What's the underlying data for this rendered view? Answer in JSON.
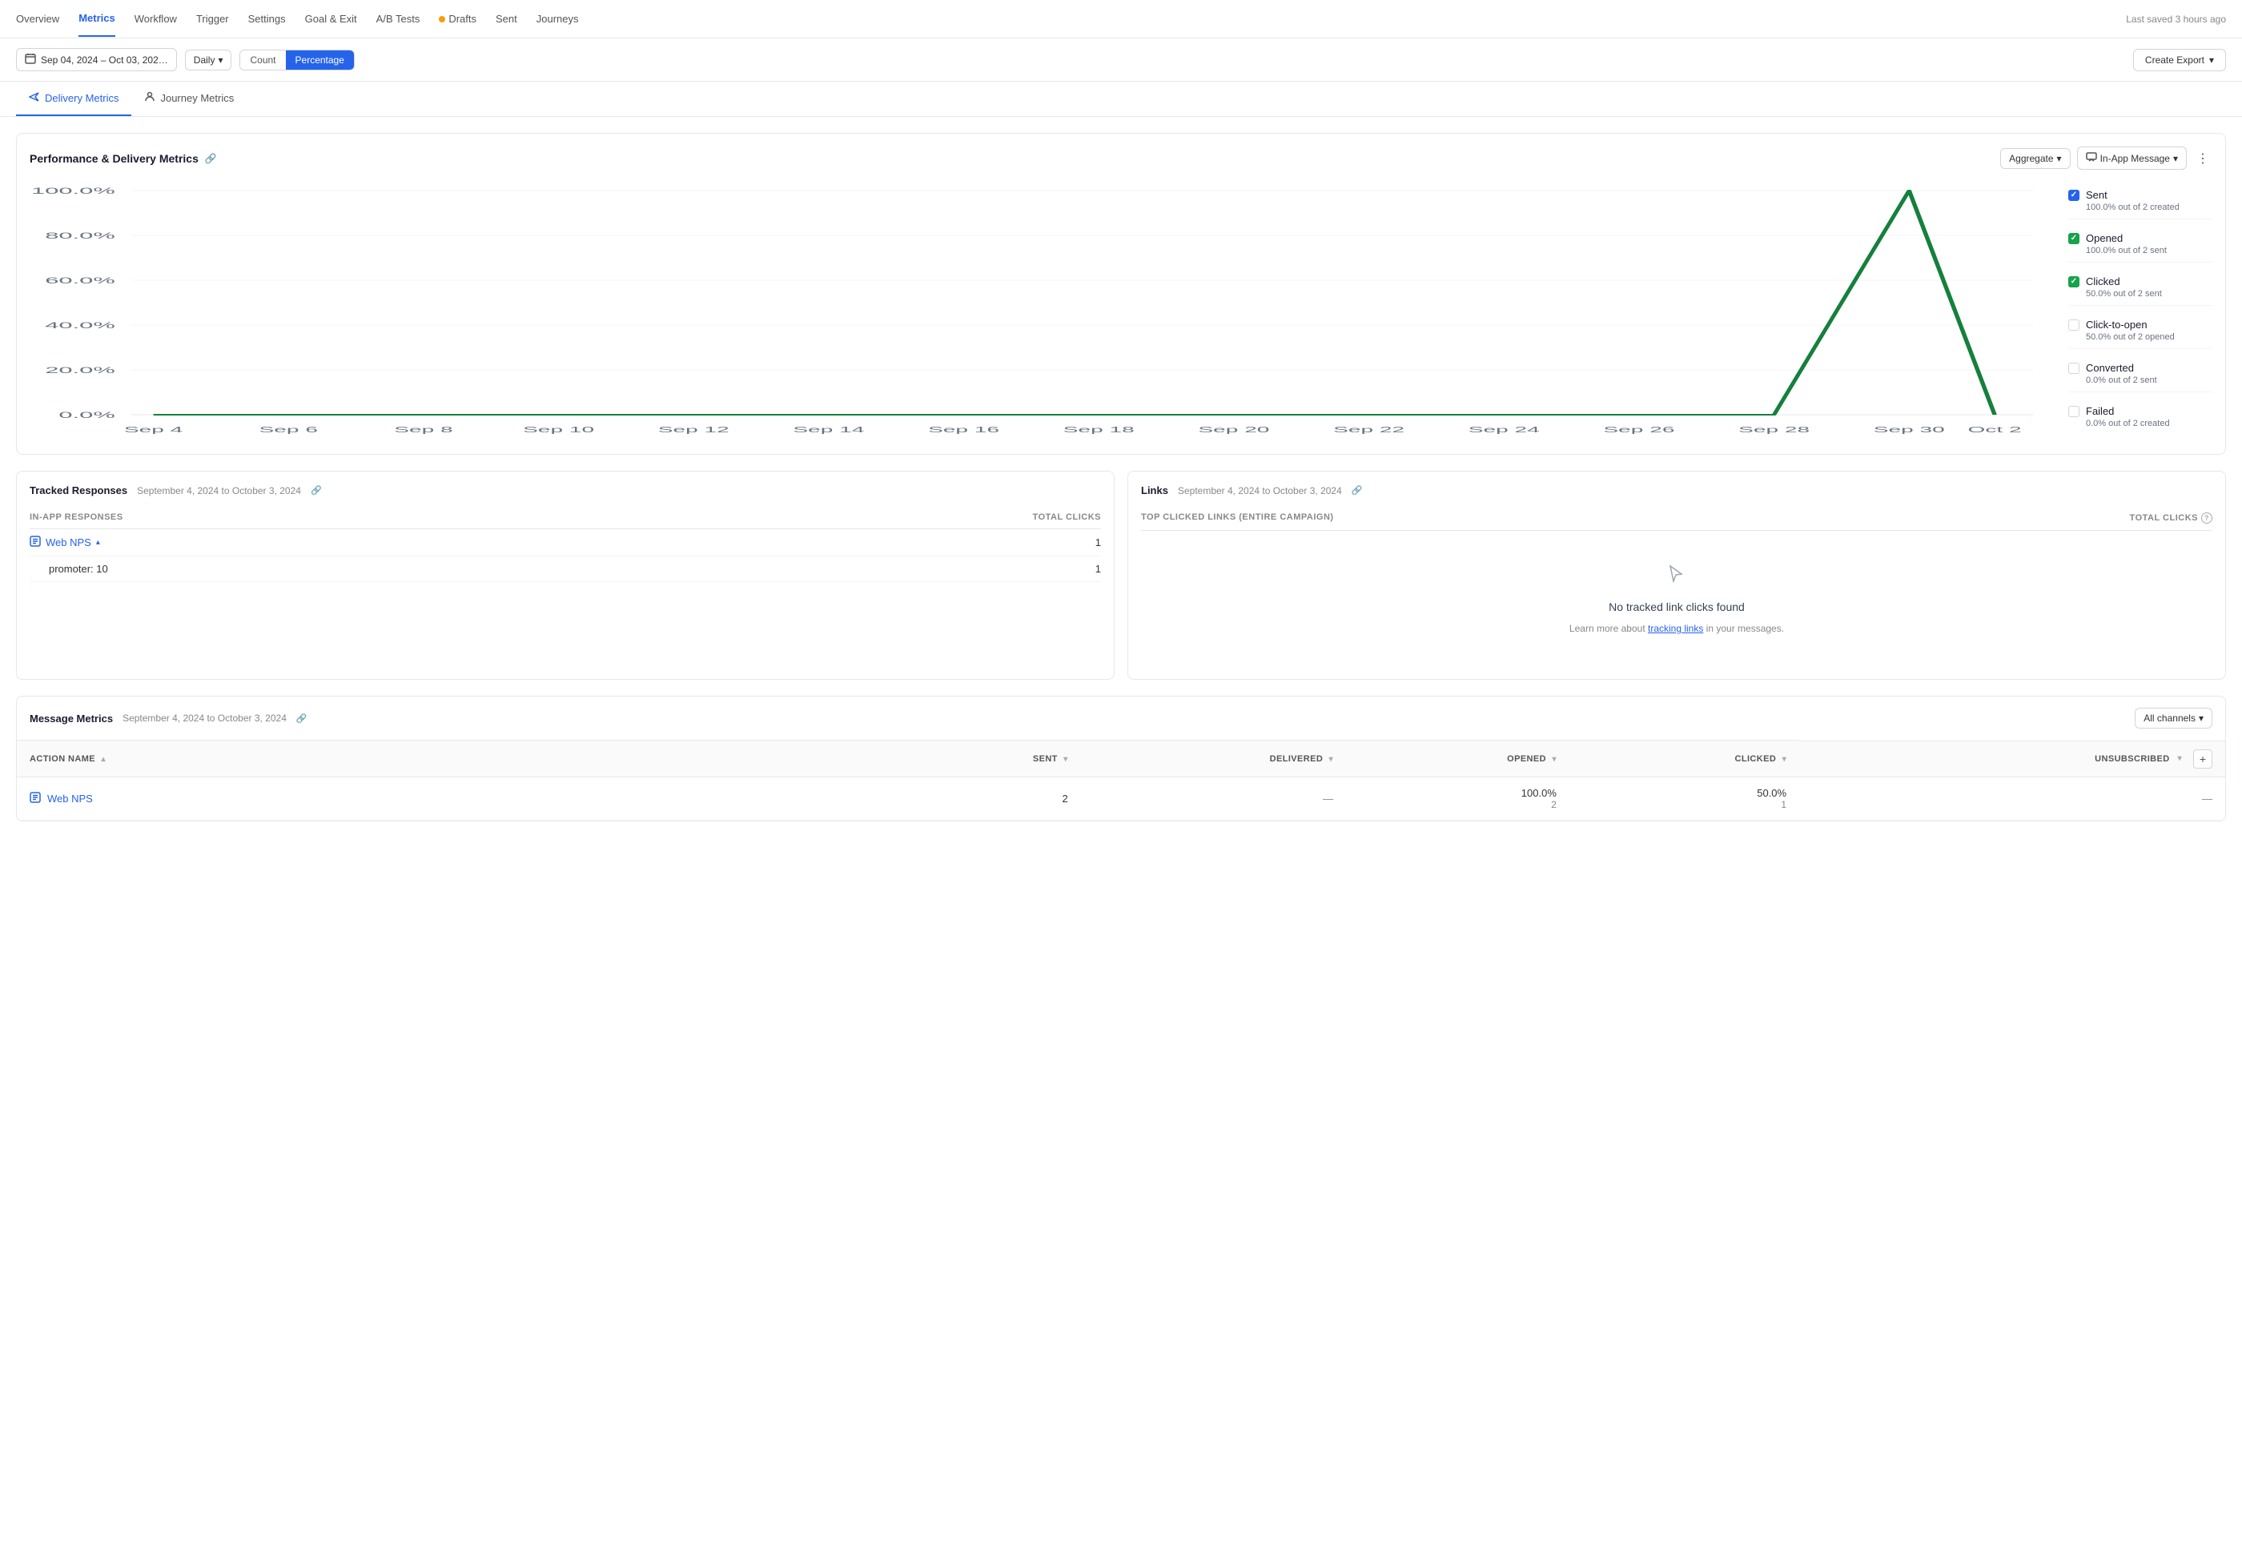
{
  "nav": {
    "items": [
      {
        "label": "Overview",
        "active": false
      },
      {
        "label": "Metrics",
        "active": true
      },
      {
        "label": "Workflow",
        "active": false
      },
      {
        "label": "Trigger",
        "active": false
      },
      {
        "label": "Settings",
        "active": false
      },
      {
        "label": "Goal & Exit",
        "active": false
      },
      {
        "label": "A/B Tests",
        "active": false
      },
      {
        "label": "Drafts",
        "active": false,
        "dot": true
      },
      {
        "label": "Sent",
        "active": false
      },
      {
        "label": "Journeys",
        "active": false
      }
    ],
    "last_saved": "Last saved 3 hours ago"
  },
  "toolbar": {
    "date_range": "Sep 04, 2024 – Oct 03, 202…",
    "frequency": "Daily",
    "toggle_count": "Count",
    "toggle_percentage": "Percentage",
    "export_btn": "Create Export"
  },
  "tabs": [
    {
      "label": "Delivery Metrics",
      "active": true
    },
    {
      "label": "Journey Metrics",
      "active": false
    }
  ],
  "chart": {
    "title": "Performance & Delivery Metrics",
    "aggregate_btn": "Aggregate",
    "channel_btn": "In-App Message",
    "x_labels": [
      "Sep 4",
      "Sep 6",
      "Sep 8",
      "Sep 10",
      "Sep 12",
      "Sep 14",
      "Sep 16",
      "Sep 18",
      "Sep 20",
      "Sep 22",
      "Sep 24",
      "Sep 26",
      "Sep 28",
      "Sep 30",
      "Oct 2"
    ],
    "y_labels": [
      "100.0%",
      "80.0%",
      "60.0%",
      "40.0%",
      "20.0%",
      "0.0%"
    ],
    "legend": [
      {
        "label": "Sent",
        "sub": "100.0% out of 2 created",
        "checked": true,
        "type": "blue"
      },
      {
        "label": "Opened",
        "sub": "100.0% out of 2 sent",
        "checked": true,
        "type": "green"
      },
      {
        "label": "Clicked",
        "sub": "50.0% out of 2 sent",
        "checked": true,
        "type": "green"
      },
      {
        "label": "Click-to-open",
        "sub": "50.0% out of 2 opened",
        "checked": false,
        "type": "none"
      },
      {
        "label": "Converted",
        "sub": "0.0% out of 2 sent",
        "checked": false,
        "type": "none"
      },
      {
        "label": "Failed",
        "sub": "0.0% out of 2 created",
        "checked": false,
        "type": "none"
      }
    ]
  },
  "tracked_responses": {
    "title": "Tracked Responses",
    "date_range": "September 4, 2024 to October 3, 2024",
    "col_label": "IN-APP RESPONSES",
    "col_right": "TOTAL CLICKS",
    "rows": [
      {
        "name": "Web NPS",
        "expanded": true,
        "count": "1"
      },
      {
        "name": "promoter: 10",
        "sub": true,
        "count": "1"
      }
    ]
  },
  "links": {
    "title": "Links",
    "date_range": "September 4, 2024 to October 3, 2024",
    "col_left": "TOP CLICKED LINKS (ENTIRE CAMPAIGN)",
    "col_right": "TOTAL CLICKS",
    "empty_title": "No tracked link clicks found",
    "empty_sub": "Learn more about ",
    "empty_link": "tracking links",
    "empty_sub2": " in your messages."
  },
  "message_metrics": {
    "title": "Message Metrics",
    "date_range": "September 4, 2024 to October 3, 2024",
    "all_channels_btn": "All channels",
    "cols": [
      "ACTION NAME",
      "SENT",
      "DELIVERED",
      "OPENED",
      "CLICKED",
      "UNSUBSCRIBED"
    ],
    "rows": [
      {
        "name": "Web NPS",
        "sent": "2",
        "delivered": "—",
        "opened_pct": "100.0%",
        "opened_count": "2",
        "clicked_pct": "50.0%",
        "clicked_count": "1",
        "unsubscribed": "—"
      }
    ]
  },
  "icons": {
    "calendar": "📅",
    "plane": "✈",
    "person": "👤",
    "link": "🔗",
    "cursor": "↗",
    "list": "☰",
    "plus": "+",
    "chevron_down": "▾",
    "chevron_up": "▴",
    "sort": "↕",
    "check": "✓"
  }
}
